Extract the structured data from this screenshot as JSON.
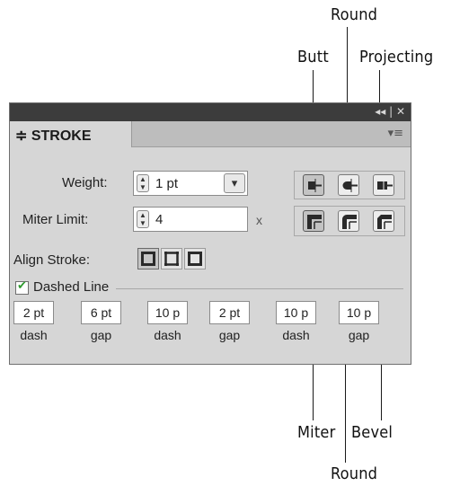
{
  "callouts": {
    "round_top": "Round",
    "butt": "Butt",
    "projecting": "Projecting",
    "miter": "Miter",
    "bevel": "Bevel",
    "round_bottom": "Round"
  },
  "panel": {
    "title_icons": "◂◂ | ✕",
    "tab_label": "≑ STROKE",
    "menu_icon": "▾≡",
    "weight": {
      "label": "Weight:",
      "value": "1 pt",
      "dropdown_icon": "▾"
    },
    "miter_limit": {
      "label": "Miter Limit:",
      "value": "4",
      "suffix": "x"
    },
    "align_stroke": {
      "label": "Align Stroke:"
    },
    "dashed_line": {
      "label": "Dashed Line",
      "checked": true,
      "check_mark": "✔"
    },
    "dashes": [
      {
        "value": "2 pt",
        "label": "dash"
      },
      {
        "value": "6 pt",
        "label": "gap"
      },
      {
        "value": "10 p",
        "label": "dash"
      },
      {
        "value": "2 pt",
        "label": "gap"
      },
      {
        "value": "10 p",
        "label": "dash"
      },
      {
        "value": "10 p",
        "label": "gap"
      }
    ]
  },
  "colors": {
    "titlebar": "#3c3c3c",
    "panel_bg": "#d6d6d6",
    "check_green": "#2f9a2f"
  }
}
